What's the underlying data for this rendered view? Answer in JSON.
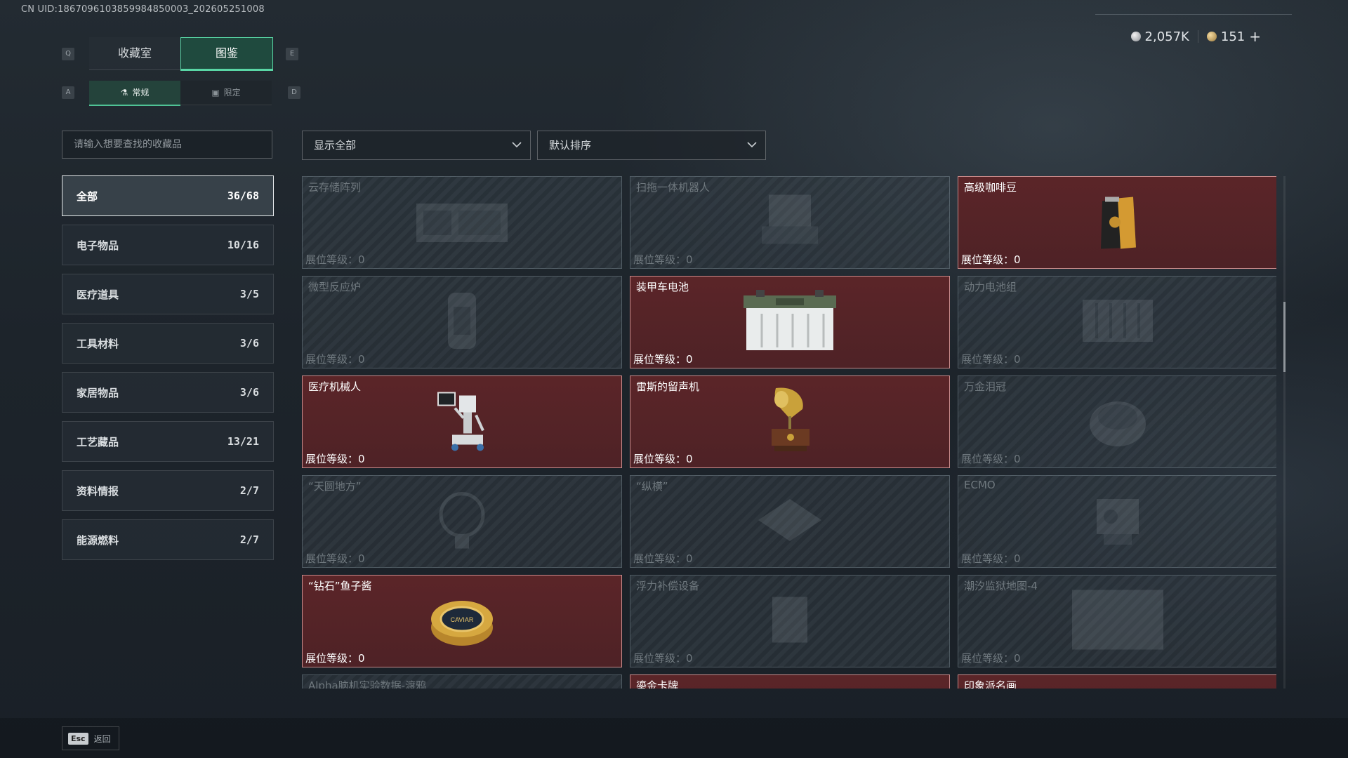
{
  "uid": "CN UID:1867096103859984850003_202605251008",
  "currency": {
    "silver": "2,057K",
    "gold": "151",
    "plus": "+"
  },
  "keys": {
    "q": "Q",
    "e": "E",
    "a": "A",
    "d": "D",
    "esc": "Esc"
  },
  "tabs": [
    {
      "label": "收藏室",
      "active": false
    },
    {
      "label": "图鉴",
      "active": true
    }
  ],
  "subtabs": [
    {
      "label": "常规",
      "active": true
    },
    {
      "label": "限定",
      "active": false
    }
  ],
  "search": {
    "placeholder": "请输入想要查找的收藏品"
  },
  "filters": {
    "show": "显示全部",
    "sort": "默认排序"
  },
  "categories": [
    {
      "name": "全部",
      "count": "36/68",
      "active": true
    },
    {
      "name": "电子物品",
      "count": "10/16",
      "active": false
    },
    {
      "name": "医疗道具",
      "count": "3/5",
      "active": false
    },
    {
      "name": "工具材料",
      "count": "3/6",
      "active": false
    },
    {
      "name": "家居物品",
      "count": "3/6",
      "active": false
    },
    {
      "name": "工艺藏品",
      "count": "13/21",
      "active": false
    },
    {
      "name": "资料情报",
      "count": "2/7",
      "active": false
    },
    {
      "name": "能源燃料",
      "count": "2/7",
      "active": false
    }
  ],
  "level_label": "展位等级：0",
  "items": [
    {
      "name": "云存储阵列",
      "owned": false,
      "icon": "server-array"
    },
    {
      "name": "扫拖一体机器人",
      "owned": false,
      "icon": "robot-vacuum"
    },
    {
      "name": "高级咖啡豆",
      "owned": true,
      "icon": "coffee-bag"
    },
    {
      "name": "微型反应炉",
      "owned": false,
      "icon": "reactor"
    },
    {
      "name": "装甲车电池",
      "owned": true,
      "icon": "battery"
    },
    {
      "name": "动力电池组",
      "owned": false,
      "icon": "battery-pack"
    },
    {
      "name": "医疗机械人",
      "owned": true,
      "icon": "medical-robot"
    },
    {
      "name": "雷斯的留声机",
      "owned": true,
      "icon": "gramophone"
    },
    {
      "name": "万金泪冠",
      "owned": false,
      "icon": "crown"
    },
    {
      "name": "“天圆地方”",
      "owned": false,
      "icon": "globe"
    },
    {
      "name": "“纵横”",
      "owned": false,
      "icon": "chessboard"
    },
    {
      "name": "ECMO",
      "owned": false,
      "icon": "ecmo-machine"
    },
    {
      "name": "“钻石”鱼子酱",
      "owned": true,
      "icon": "caviar-tin",
      "icon_text": "CAVIAR"
    },
    {
      "name": "浮力补偿设备",
      "owned": false,
      "icon": "buoyancy-vest"
    },
    {
      "name": "潮汐监狱地图-4",
      "owned": false,
      "icon": "map"
    },
    {
      "name": "Alpha脑机实验数据-渡鸦",
      "owned": false,
      "icon": "data-drive"
    },
    {
      "name": "鎏金卡牌",
      "owned": true,
      "icon": "card"
    },
    {
      "name": "印象派名画",
      "owned": true,
      "icon": "painting"
    }
  ],
  "footer": {
    "back": "返回"
  }
}
